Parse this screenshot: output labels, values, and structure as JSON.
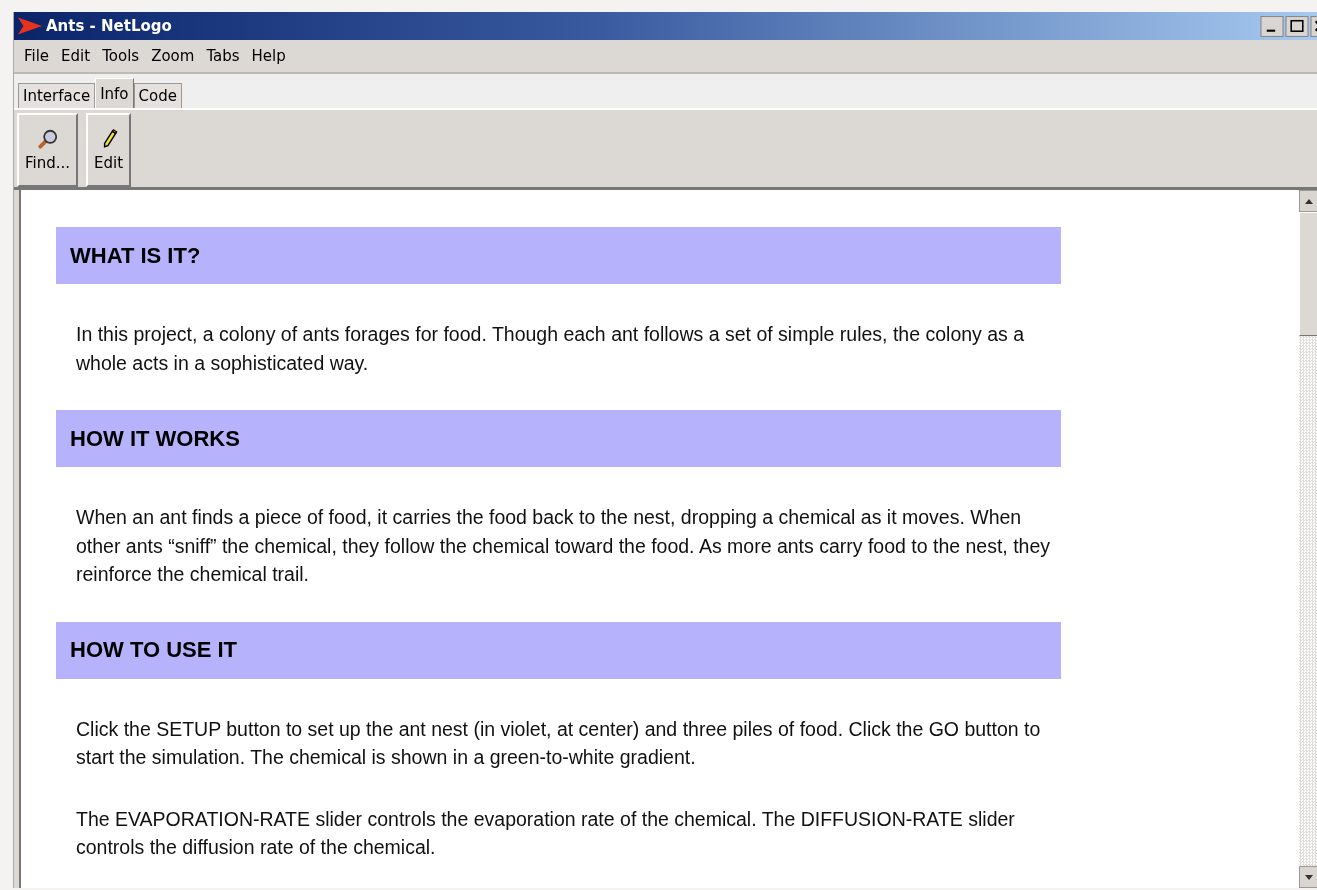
{
  "window": {
    "title": "Ants - NetLogo"
  },
  "menu": [
    "File",
    "Edit",
    "Tools",
    "Zoom",
    "Tabs",
    "Help"
  ],
  "tabs": [
    {
      "label": "Interface",
      "selected": false
    },
    {
      "label": "Info",
      "selected": true
    },
    {
      "label": "Code",
      "selected": false
    }
  ],
  "toolbar": [
    {
      "kind": "find",
      "label": "Find..."
    },
    {
      "kind": "edit",
      "label": "Edit"
    }
  ],
  "sections": [
    {
      "heading": "WHAT IS IT?",
      "paragraphs": [
        "In this project, a colony of ants forages for food. Though each ant follows a set of simple rules, the colony as a whole acts in a sophisticated way."
      ]
    },
    {
      "heading": "HOW IT WORKS",
      "paragraphs": [
        "When an ant finds a piece of food, it carries the food back to the nest, dropping a chemical as it moves. When other ants “sniff” the chemical, they follow the chemical toward the food. As more ants carry food to the nest, they reinforce the chemical trail."
      ]
    },
    {
      "heading": "HOW TO USE IT",
      "paragraphs": [
        "Click the SETUP button to set up the ant nest (in violet, at center) and three piles of food. Click the GO button to start the simulation. The chemical is shown in a green-to-white gradient.",
        "The EVAPORATION-RATE slider controls the evaporation rate of the chemical. The DIFFUSION-RATE slider controls the diffusion rate of the chemical."
      ]
    }
  ]
}
